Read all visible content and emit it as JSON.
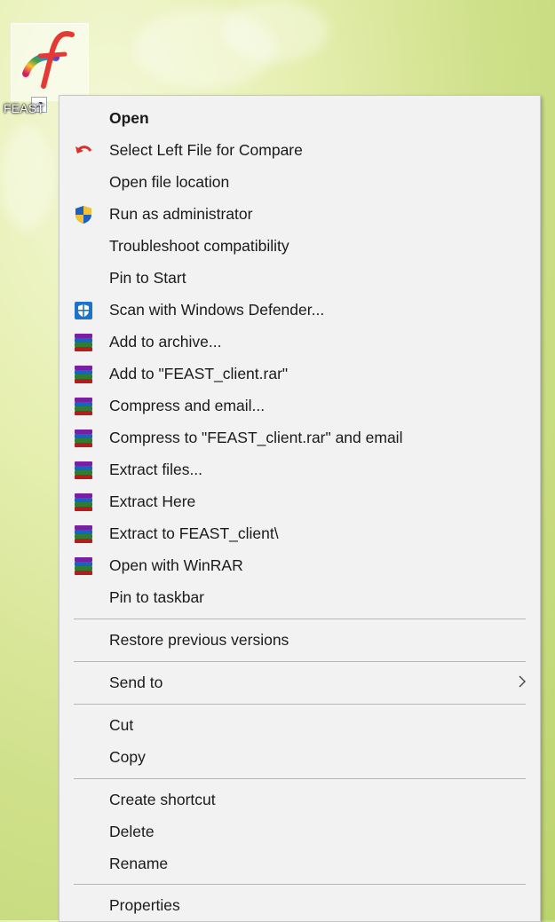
{
  "desktop": {
    "icon_label": "FEAST"
  },
  "menu": {
    "items": [
      {
        "label": "Open",
        "icon": "none",
        "bold": true
      },
      {
        "label": "Select Left File for Compare",
        "icon": "compare-arrow-icon"
      },
      {
        "label": "Open file location",
        "icon": "none"
      },
      {
        "label": "Run as administrator",
        "icon": "uac-shield-icon"
      },
      {
        "label": "Troubleshoot compatibility",
        "icon": "none"
      },
      {
        "label": "Pin to Start",
        "icon": "none"
      },
      {
        "label": "Scan with Windows Defender...",
        "icon": "defender-icon"
      },
      {
        "label": "Add to archive...",
        "icon": "winrar-icon"
      },
      {
        "label": "Add to \"FEAST_client.rar\"",
        "icon": "winrar-icon"
      },
      {
        "label": "Compress and email...",
        "icon": "winrar-icon"
      },
      {
        "label": "Compress to \"FEAST_client.rar\" and email",
        "icon": "winrar-icon"
      },
      {
        "label": "Extract files...",
        "icon": "winrar-icon"
      },
      {
        "label": "Extract Here",
        "icon": "winrar-icon"
      },
      {
        "label": "Extract to FEAST_client\\",
        "icon": "winrar-icon"
      },
      {
        "label": "Open with WinRAR",
        "icon": "winrar-icon"
      },
      {
        "label": "Pin to taskbar",
        "icon": "none"
      },
      {
        "label": "Restore previous versions",
        "icon": "none"
      },
      {
        "label": "Send to",
        "icon": "none",
        "submenu": true
      },
      {
        "label": "Cut",
        "icon": "none"
      },
      {
        "label": "Copy",
        "icon": "none"
      },
      {
        "label": "Create shortcut",
        "icon": "none"
      },
      {
        "label": "Delete",
        "icon": "none"
      },
      {
        "label": "Rename",
        "icon": "none"
      },
      {
        "label": "Properties",
        "icon": "none"
      }
    ]
  },
  "colors": {
    "menu_bg": "#f2f2f2",
    "separator": "#b5b5b5",
    "defender_blue": "#1e73c8",
    "shield_blue": "#1f5fbf",
    "shield_yellow": "#f2c230",
    "compare_red": "#d9302c"
  }
}
